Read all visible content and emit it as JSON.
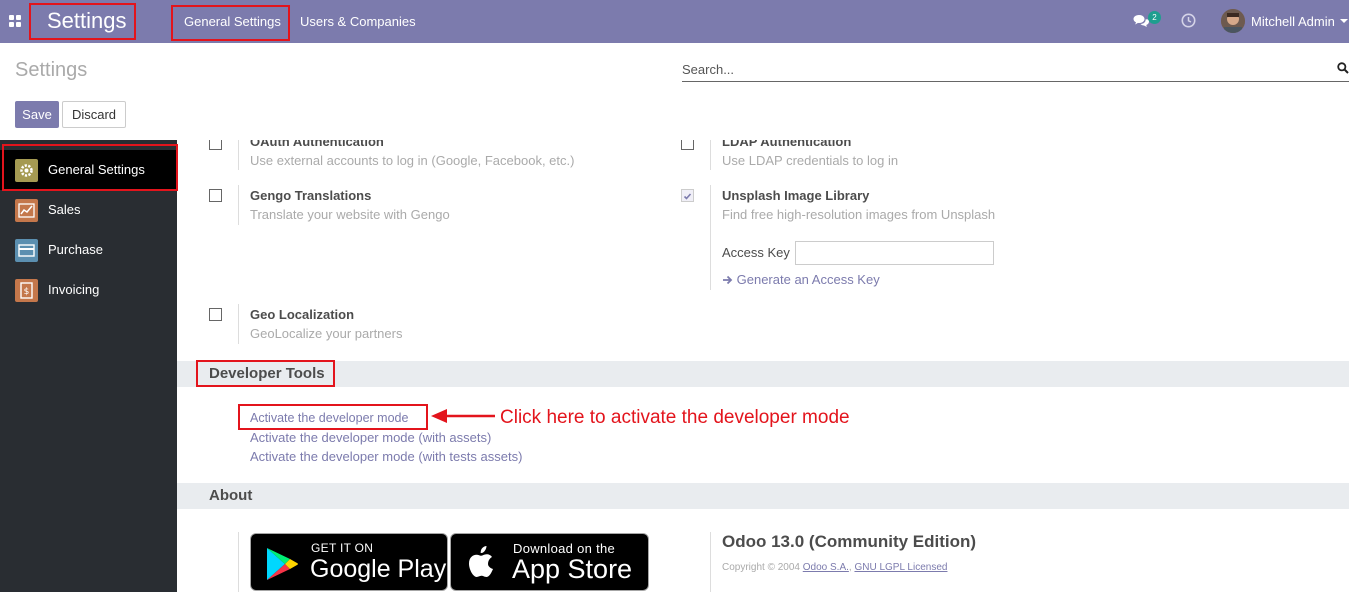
{
  "navbar": {
    "brand": "Settings",
    "menu": [
      "General Settings",
      "Users & Companies"
    ],
    "message_count": "2",
    "user": "Mitchell Admin"
  },
  "control_panel": {
    "title": "Settings",
    "search_placeholder": "Search...",
    "save_label": "Save",
    "discard_label": "Discard"
  },
  "sidebar": {
    "items": [
      {
        "label": "General Settings",
        "icon": "gear-icon",
        "color": "#a59a52"
      },
      {
        "label": "Sales",
        "icon": "chart-icon",
        "color": "#c4774b"
      },
      {
        "label": "Purchase",
        "icon": "card-icon",
        "color": "#5b8fb0"
      },
      {
        "label": "Invoicing",
        "icon": "invoice-icon",
        "color": "#c4774b"
      }
    ]
  },
  "settings": {
    "oauth": {
      "title": "OAuth Authentication",
      "desc": "Use external accounts to log in (Google, Facebook, etc.)"
    },
    "ldap": {
      "title": "LDAP Authentication",
      "desc": "Use LDAP credentials to log in"
    },
    "gengo": {
      "title": "Gengo Translations",
      "desc": "Translate your website with Gengo"
    },
    "unsplash": {
      "title": "Unsplash Image Library",
      "desc": "Find free high-resolution images from Unsplash",
      "access_key_label": "Access Key",
      "access_key_value": "",
      "generate_link": "Generate an Access Key"
    },
    "geo": {
      "title": "Geo Localization",
      "desc": "GeoLocalize your partners"
    }
  },
  "developer_tools": {
    "title": "Developer Tools",
    "links": [
      "Activate the developer mode",
      "Activate the developer mode (with assets)",
      "Activate the developer mode (with tests assets)"
    ],
    "annotation": "Click here to activate the developer mode"
  },
  "about": {
    "title": "About",
    "google_play": {
      "small": "GET IT ON",
      "big": "Google Play"
    },
    "app_store": {
      "small": "Download on the",
      "big": "App Store"
    },
    "version": "Odoo 13.0 (Community Edition)",
    "copyright": "Copyright © 2004",
    "company_link": "Odoo S.A.",
    "license_link": "GNU LGPL Licensed"
  },
  "colors": {
    "primary": "#7c7bad",
    "annotation": "#e3141c",
    "sidebar": "#292d32"
  }
}
